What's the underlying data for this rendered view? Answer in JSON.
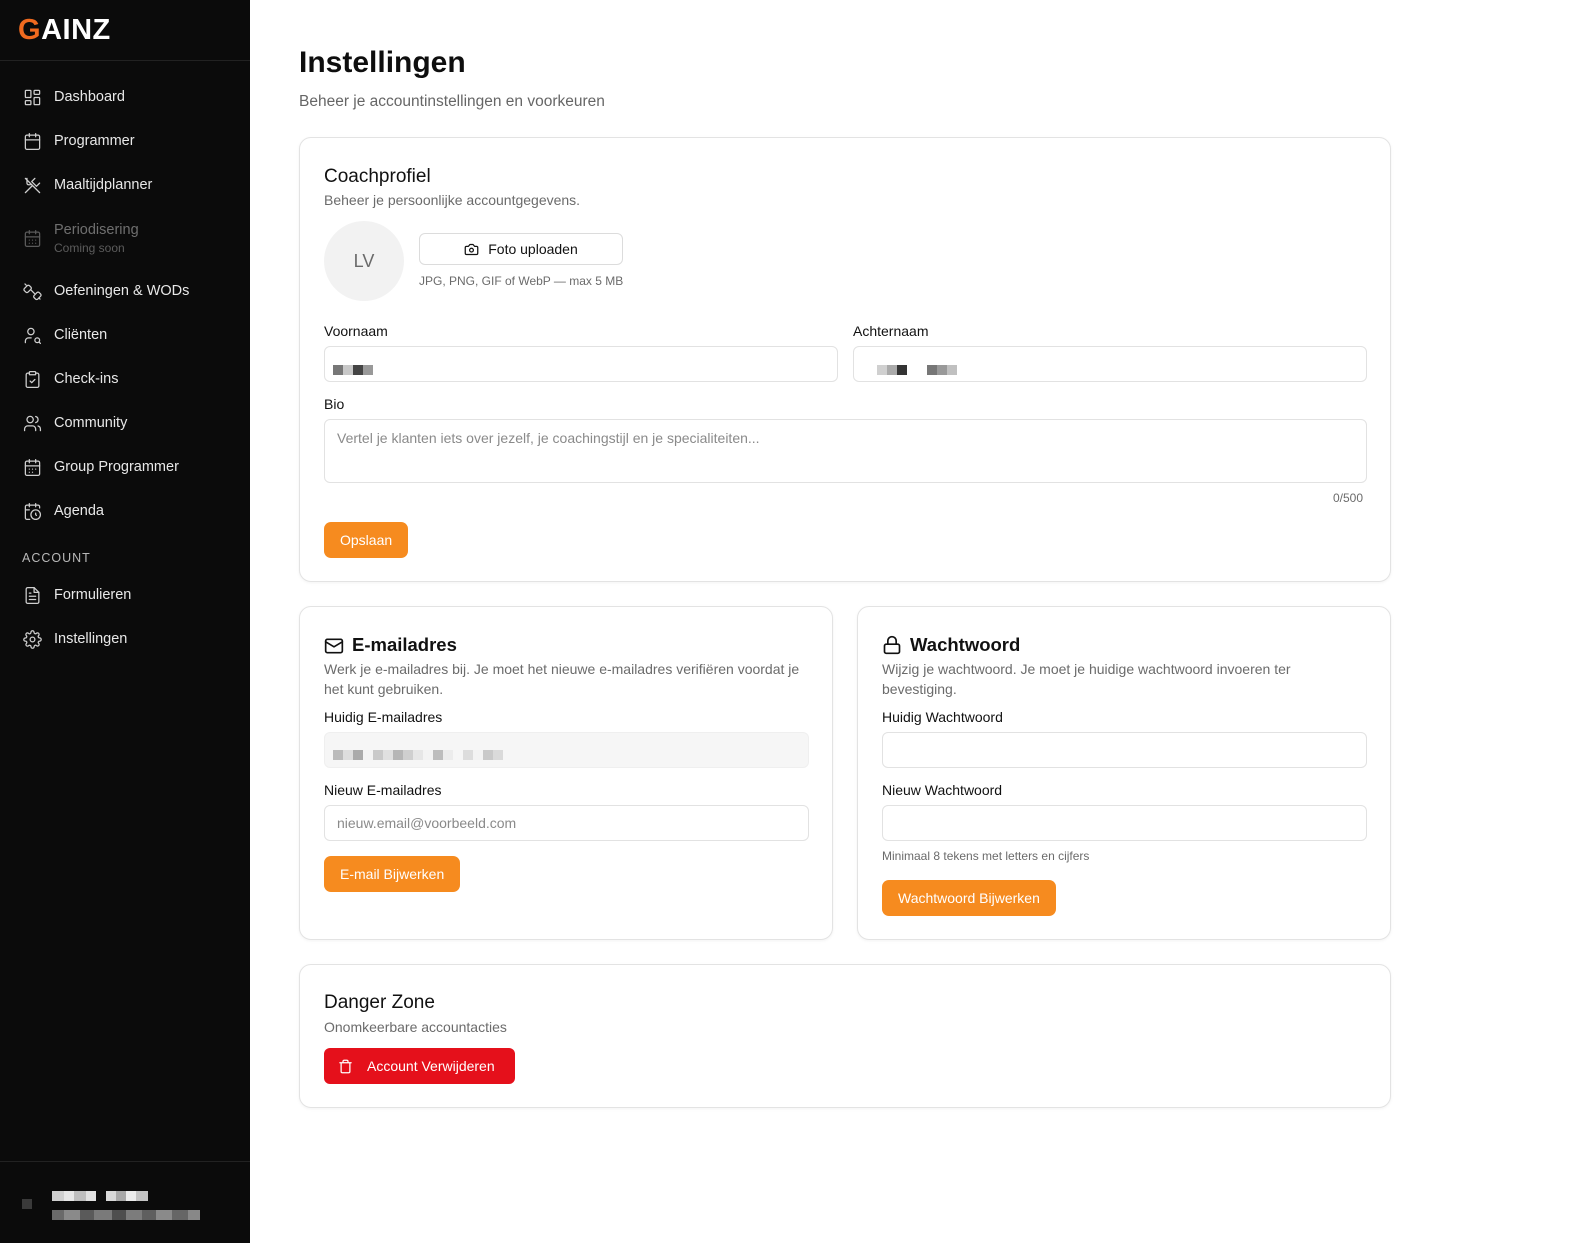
{
  "brand": {
    "logo_first": "G",
    "logo_rest": "AINZ"
  },
  "sidebar": {
    "items": [
      {
        "label": "Dashboard",
        "icon": "dashboard-icon"
      },
      {
        "label": "Programmer",
        "icon": "calendar-icon"
      },
      {
        "label": "Maaltijdplanner",
        "icon": "utensils-icon"
      },
      {
        "label": "Periodisering",
        "sublabel": "Coming soon",
        "icon": "calendar-grid-icon",
        "disabled": true
      },
      {
        "label": "Oefeningen & WODs",
        "icon": "dumbbell-icon"
      },
      {
        "label": "Cliënten",
        "icon": "user-search-icon"
      },
      {
        "label": "Check-ins",
        "icon": "clipboard-check-icon"
      },
      {
        "label": "Community",
        "icon": "users-icon"
      },
      {
        "label": "Group Programmer",
        "icon": "calendar-days-icon"
      },
      {
        "label": "Agenda",
        "icon": "calendar-clock-icon"
      }
    ],
    "section_label": "ACCOUNT",
    "account_items": [
      {
        "label": "Formulieren",
        "icon": "file-text-icon"
      },
      {
        "label": "Instellingen",
        "icon": "settings-icon"
      }
    ]
  },
  "page": {
    "title": "Instellingen",
    "subtitle": "Beheer je accountinstellingen en voorkeuren"
  },
  "profile": {
    "title": "Coachprofiel",
    "description": "Beheer je persoonlijke accountgegevens.",
    "avatar_initials": "LV",
    "upload_label": "Foto uploaden",
    "upload_hint": "JPG, PNG, GIF of WebP — max 5 MB",
    "first_name_label": "Voornaam",
    "last_name_label": "Achternaam",
    "bio_label": "Bio",
    "bio_placeholder": "Vertel je klanten iets over jezelf, je coachingstijl en je specialiteiten...",
    "bio_counter": "0/500",
    "save_label": "Opslaan"
  },
  "email": {
    "title": "E-mailadres",
    "description": "Werk je e-mailadres bij. Je moet het nieuwe e-mailadres verifiëren voordat je het kunt gebruiken.",
    "current_label": "Huidig E-mailadres",
    "new_label": "Nieuw E-mailadres",
    "new_placeholder": "nieuw.email@voorbeeld.com",
    "submit_label": "E-mail Bijwerken"
  },
  "password": {
    "title": "Wachtwoord",
    "description": "Wijzig je wachtwoord. Je moet je huidige wachtwoord invoeren ter bevestiging.",
    "current_label": "Huidig Wachtwoord",
    "new_label": "Nieuw Wachtwoord",
    "hint": "Minimaal 8 tekens met letters en cijfers",
    "submit_label": "Wachtwoord Bijwerken"
  },
  "danger": {
    "title": "Danger Zone",
    "description": "Onomkeerbare accountacties",
    "delete_label": "Account Verwijderen"
  },
  "colors": {
    "accent": "#f68b1f",
    "danger": "#e5101b",
    "sidebar_bg": "#0b0b0b",
    "logo_accent": "#f06a1f"
  }
}
